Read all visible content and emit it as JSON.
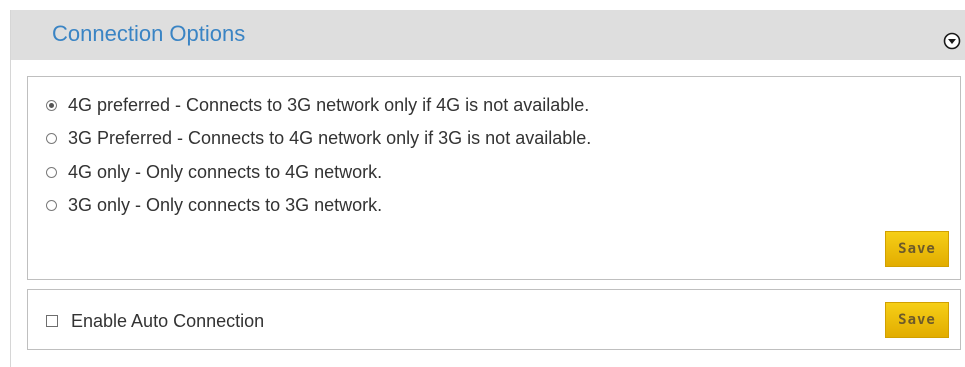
{
  "header": {
    "title": "Connection Options",
    "collapse_icon": "chevron-down-circle-icon"
  },
  "network_mode": {
    "options": [
      {
        "label": "4G preferred - Connects to 3G network only if 4G is not available.",
        "selected": true
      },
      {
        "label": "3G Preferred - Connects to 4G network only if 3G is not available.",
        "selected": false
      },
      {
        "label": "4G only - Only connects to 4G network.",
        "selected": false
      },
      {
        "label": "3G only - Only connects to 3G network.",
        "selected": false
      }
    ],
    "save_label": "Save"
  },
  "auto_connection": {
    "label": "Enable Auto Connection",
    "checked": false,
    "save_label": "Save"
  },
  "colors": {
    "title": "#3a84c4",
    "header_bg": "#dedede",
    "save_button": "#f0c20a"
  }
}
